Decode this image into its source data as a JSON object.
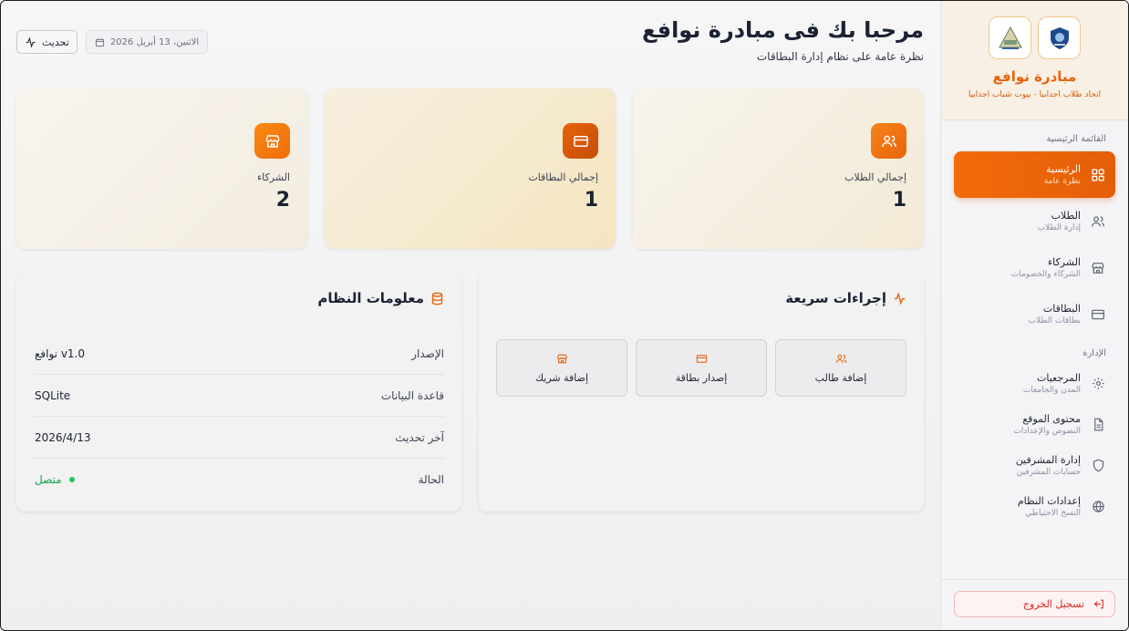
{
  "sidebar": {
    "title": "مبادرة نوافع",
    "subtitle": "اتحاد طلاب اجدابيا - بيوت شباب اجدابيا",
    "main_section": "القائمة الرئيسية",
    "admin_section": "الإدارة",
    "items": [
      {
        "label": "الرئيسية",
        "sub": "نظرة عامة",
        "icon": "dashboard-grid-icon",
        "active": true
      },
      {
        "label": "الطلاب",
        "sub": "إدارة الطلاب",
        "icon": "users-icon"
      },
      {
        "label": "الشركاء",
        "sub": "الشركاء والخصومات",
        "icon": "store-icon"
      },
      {
        "label": "البطاقات",
        "sub": "بطاقات الطلاب",
        "icon": "credit-card-icon"
      }
    ],
    "admin_items": [
      {
        "label": "المرجعيات",
        "sub": "المدن والجامعات",
        "icon": "gear-icon"
      },
      {
        "label": "محتوى الموقع",
        "sub": "النصوص والإعدادات",
        "icon": "document-icon"
      },
      {
        "label": "إدارة المشرفين",
        "sub": "حسابات المشرفين",
        "icon": "shield-icon"
      },
      {
        "label": "إعدادات النظام",
        "sub": "النسخ الاحتياطي",
        "icon": "globe-icon"
      }
    ],
    "logout": "تسجيل الخروج"
  },
  "header": {
    "title": "مرحبا بك فى مبادرة نوافع",
    "subtitle": "نظرة عامة على نظام إدارة البطاقات",
    "date": "الاثنين، 13 أبريل 2026",
    "refresh": "تحديث"
  },
  "stats": [
    {
      "label": "إجمالي الطلاب",
      "value": "1",
      "icon": "users-icon"
    },
    {
      "label": "إجمالي البطاقات",
      "value": "1",
      "icon": "credit-card-icon"
    },
    {
      "label": "الشركاء",
      "value": "2",
      "icon": "store-icon"
    }
  ],
  "quick_actions": {
    "title": "إجراءات سريعة",
    "items": [
      {
        "label": "إضافة طالب",
        "icon": "users-icon"
      },
      {
        "label": "إصدار بطاقة",
        "icon": "credit-card-icon"
      },
      {
        "label": "إضافة شريك",
        "icon": "store-icon"
      }
    ]
  },
  "system_info": {
    "title": "معلومات النظام",
    "rows": [
      {
        "key": "الإصدار",
        "value": "نوافع v1.0"
      },
      {
        "key": "قاعدة البيانات",
        "value": "SQLite"
      },
      {
        "key": "آخر تحديث",
        "value": "2026/4/13"
      },
      {
        "key": "الحالة",
        "value": "متصل"
      }
    ]
  },
  "colors": {
    "accent": "#f26a0b",
    "danger": "#dc2626",
    "success": "#16a34a"
  }
}
